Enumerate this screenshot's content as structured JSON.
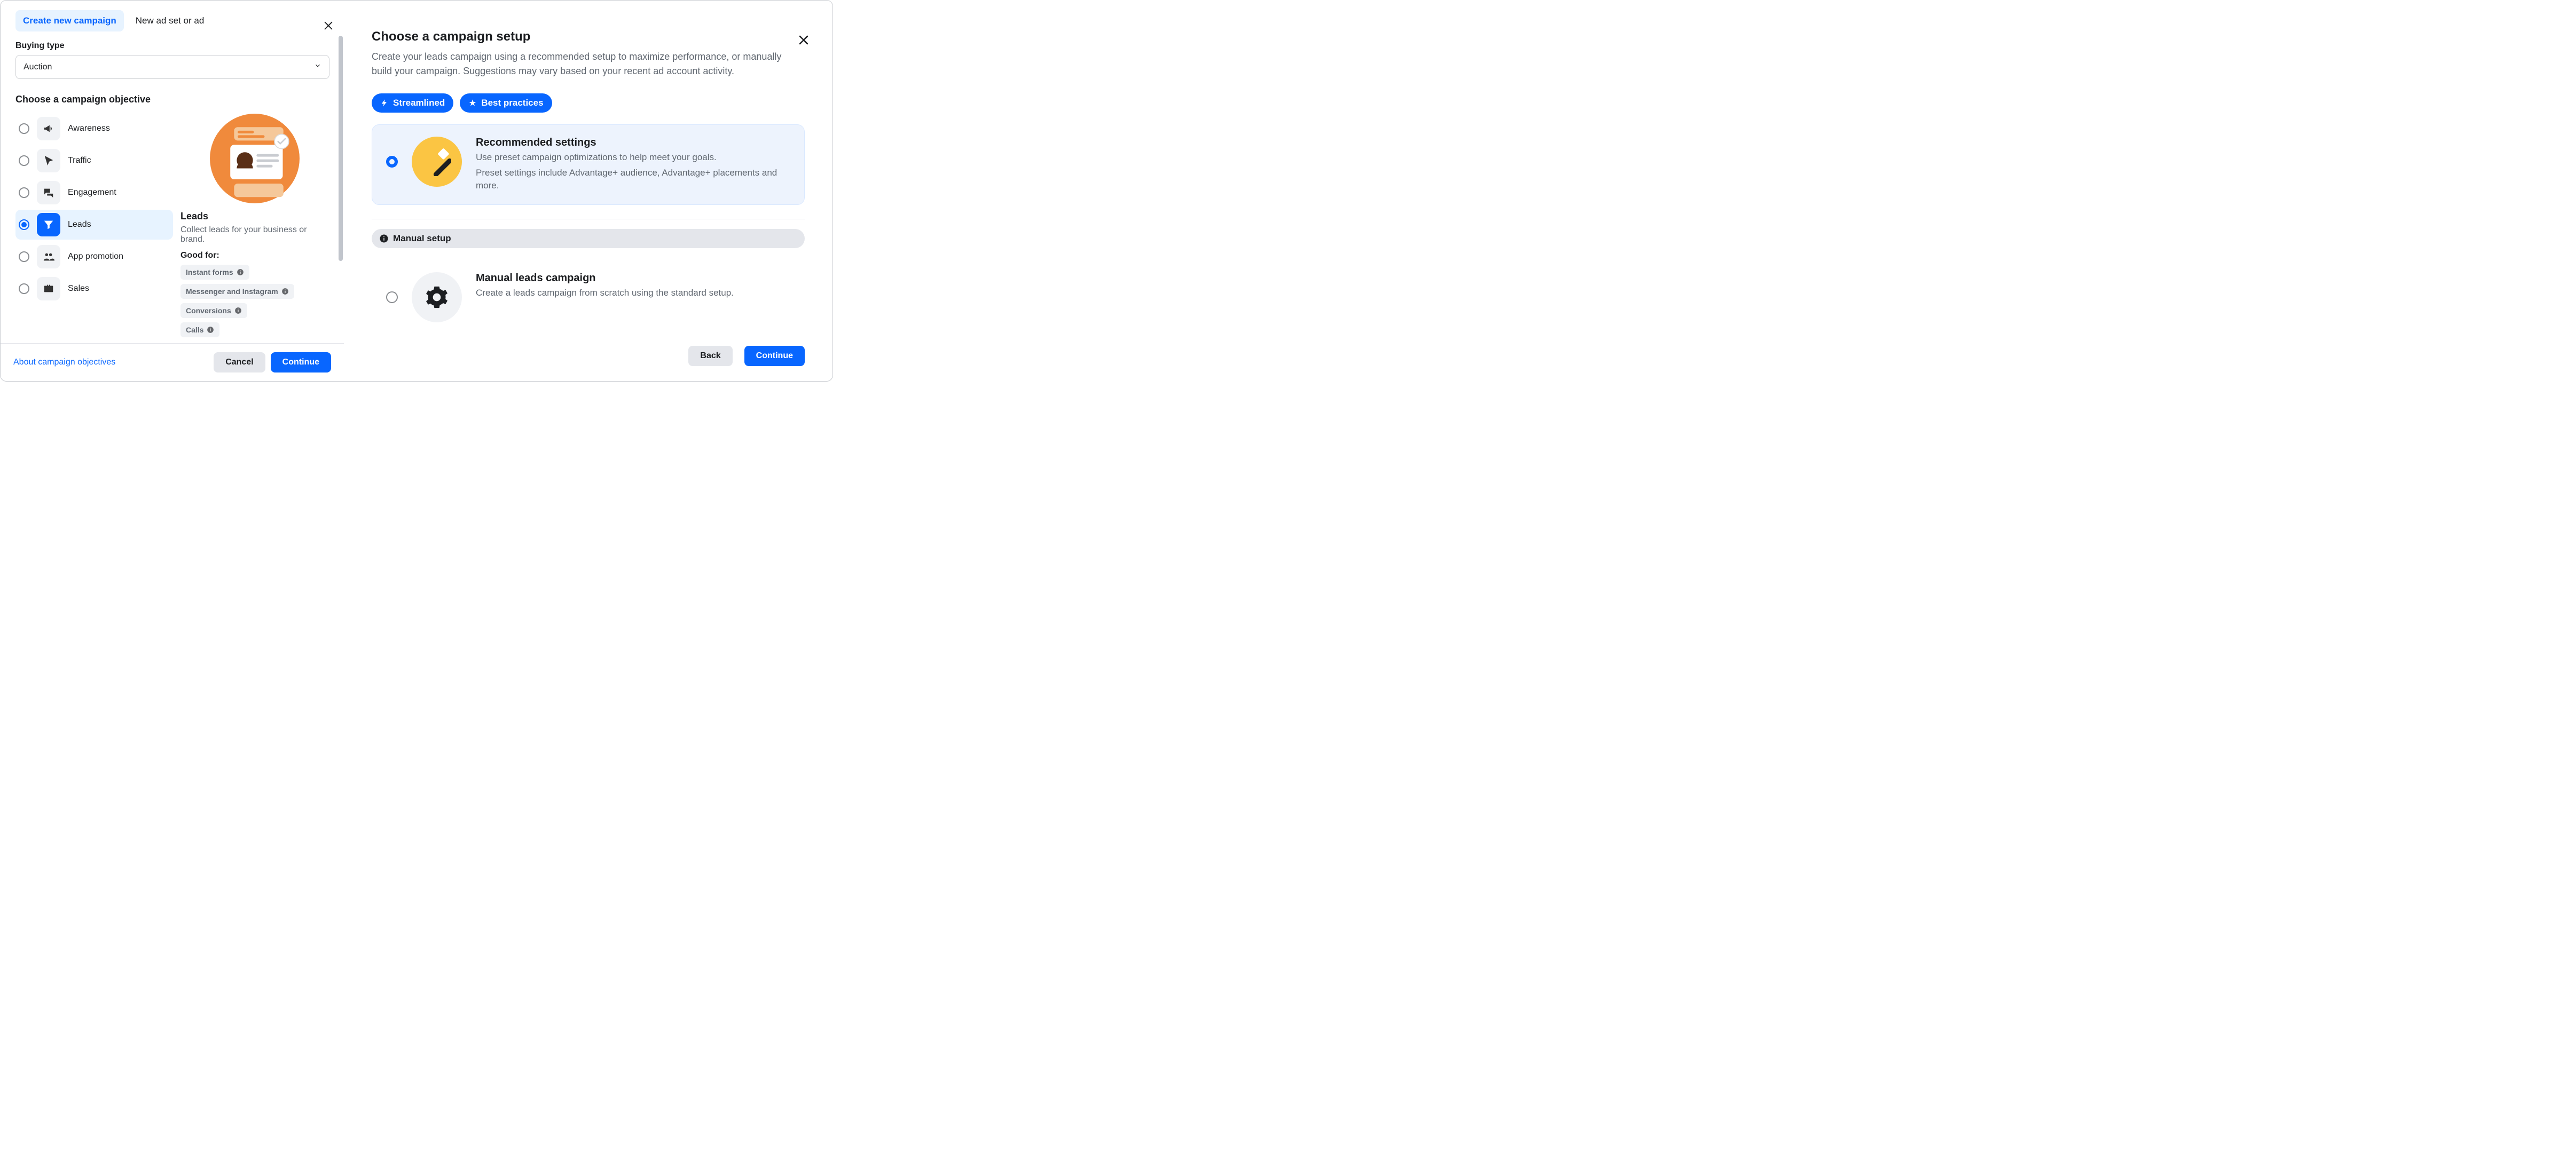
{
  "left": {
    "tabs": {
      "create": "Create new campaign",
      "adset": "New ad set or ad"
    },
    "buying_type_label": "Buying type",
    "buying_type_value": "Auction",
    "objective_label": "Choose a campaign objective",
    "objectives": {
      "awareness": "Awareness",
      "traffic": "Traffic",
      "engagement": "Engagement",
      "leads": "Leads",
      "app_promo": "App promotion",
      "sales": "Sales"
    },
    "detail": {
      "title": "Leads",
      "sub": "Collect leads for your business or brand.",
      "good_for": "Good for:",
      "good_items": {
        "a": "Instant forms",
        "b": "Messenger and Instagram",
        "c": "Conversions",
        "d": "Calls"
      }
    },
    "footer": {
      "link": "About campaign objectives",
      "cancel": "Cancel",
      "continue": "Continue"
    }
  },
  "right": {
    "title": "Choose a campaign setup",
    "desc": "Create your leads campaign using a recommended setup to maximize performance, or manually build your campaign. Suggestions may vary based on your recent ad account activity.",
    "pills": {
      "a": "Streamlined",
      "b": "Best practices"
    },
    "rec": {
      "title": "Recommended settings",
      "l1": "Use preset campaign optimizations to help meet your goals.",
      "l2": "Preset settings include Advantage+ audience, Advantage+ placements and more."
    },
    "manual_pill": "Manual setup",
    "manual": {
      "title": "Manual leads campaign",
      "sub": "Create a leads campaign from scratch using the standard setup."
    },
    "footer": {
      "back": "Back",
      "continue": "Continue"
    }
  }
}
